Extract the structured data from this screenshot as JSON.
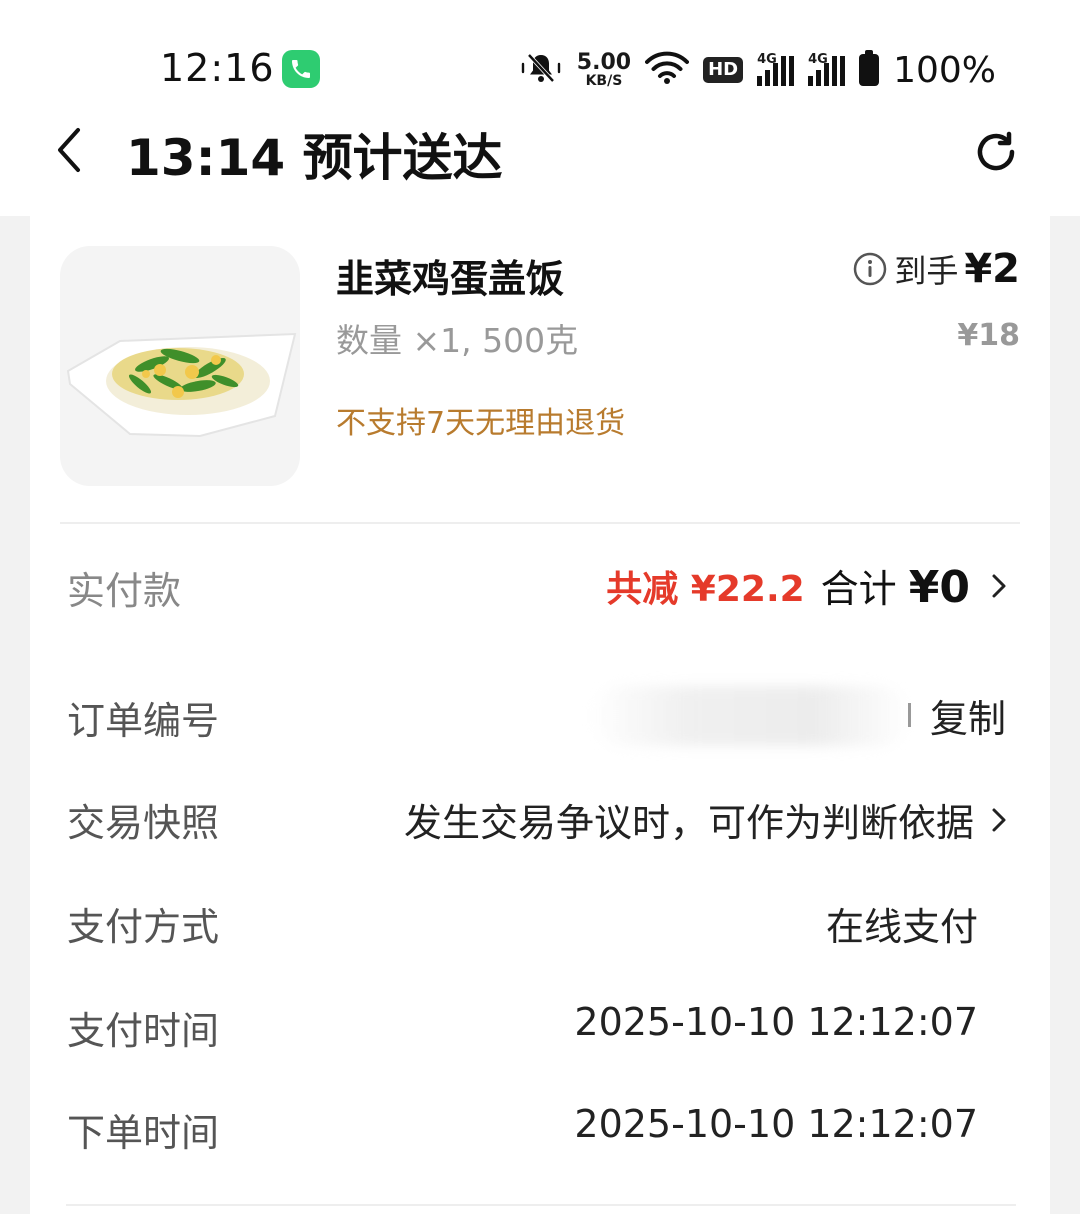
{
  "status_bar": {
    "time": "12:16",
    "net_speed_value": "5.00",
    "net_speed_unit": "KB/S",
    "hd_label": "HD",
    "signal_1_label": "4G",
    "signal_2_label": "4G",
    "battery": "100%",
    "call_badge_color": "#2ecc71"
  },
  "header": {
    "title": "13:14 预计送达"
  },
  "product": {
    "name": "韭菜鸡蛋盖饭",
    "qty": "数量 ×1, 500克",
    "note": "不支持7天无理由退货",
    "final_price_label": "到手",
    "final_price": "¥2",
    "original_price": "¥18"
  },
  "payment": {
    "label": "实付款",
    "discount": "共减 ¥22.2",
    "total_label": "合计 ",
    "total": "¥0"
  },
  "details": {
    "order_id_label": "订单编号",
    "copy_label": "复制",
    "snapshot_label": "交易快照",
    "snapshot_value": "发生交易争议时，可作为判断依据",
    "pay_method_label": "支付方式",
    "pay_method_value": "在线支付",
    "pay_time_label": "支付时间",
    "pay_time_value": "2025-10-10 12:12:07",
    "order_time_label": "下单时间",
    "order_time_value": "2025-10-10 12:12:07"
  },
  "colors": {
    "discount": "#e53a2a",
    "note": "#b87b2e",
    "muted": "#999999"
  }
}
